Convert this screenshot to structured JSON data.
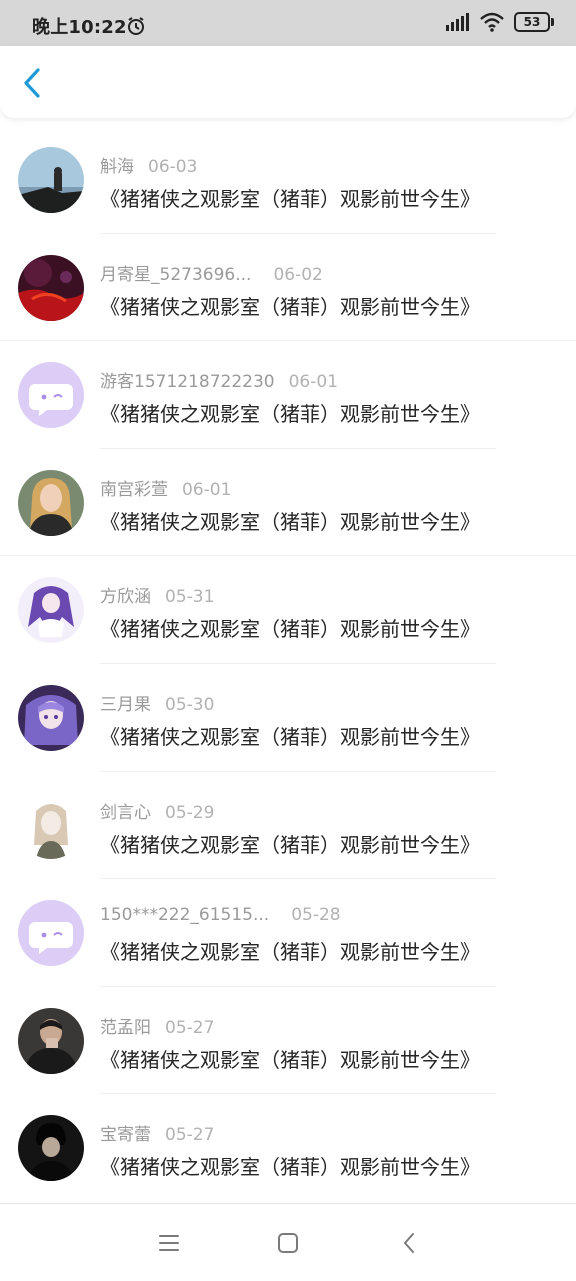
{
  "status_bar": {
    "time": "晚上10:22",
    "battery": "53",
    "icons": [
      "alarm-icon",
      "signal-icon",
      "wifi-icon",
      "battery-icon"
    ]
  },
  "header": {
    "back_icon": "chevron-left-icon",
    "accent_color": "#1e9bd7"
  },
  "list": {
    "items": [
      {
        "name": "斛海",
        "date": "06-03",
        "title": "《猪猪侠之观影室（猪菲）观影前世今生》",
        "avatar": "photo-seaside"
      },
      {
        "name": "月寄星_5273696...",
        "date": "06-02",
        "title": "《猪猪侠之观影室（猪菲）观影前世今生》",
        "avatar": "photo-red-night"
      },
      {
        "name": "游客1571218722230",
        "date": "06-01",
        "title": "《猪猪侠之观影室（猪菲）观影前世今生》",
        "avatar": "default-chat-bubble"
      },
      {
        "name": "南宫彩萱",
        "date": "06-01",
        "title": "《猪猪侠之观影室（猪菲）观影前世今生》",
        "avatar": "photo-blonde-girl"
      },
      {
        "name": "方欣涵",
        "date": "05-31",
        "title": "《猪猪侠之观影室（猪菲）观影前世今生》",
        "avatar": "anime-purple"
      },
      {
        "name": "三月果",
        "date": "05-30",
        "title": "《猪猪侠之观影室（猪菲）观影前世今生》",
        "avatar": "anime-violet"
      },
      {
        "name": "剑言心",
        "date": "05-29",
        "title": "《猪猪侠之观影室（猪菲）观影前世今生》",
        "avatar": "sketch-girl"
      },
      {
        "name": "150***222_61515...",
        "date": "05-28",
        "title": "《猪猪侠之观影室（猪菲）观影前世今生》",
        "avatar": "default-chat-bubble"
      },
      {
        "name": "范孟阳",
        "date": "05-27",
        "title": "《猪猪侠之观影室（猪菲）观影前世今生》",
        "avatar": "photo-dark-man"
      },
      {
        "name": "宝寄蕾",
        "date": "05-27",
        "title": "《猪猪侠之观影室（猪菲）观影前世今生》",
        "avatar": "photo-dark-boy"
      }
    ]
  },
  "bottom_nav": {
    "icons": [
      "menu-icon",
      "home-square-icon",
      "back-arrow-icon"
    ]
  }
}
